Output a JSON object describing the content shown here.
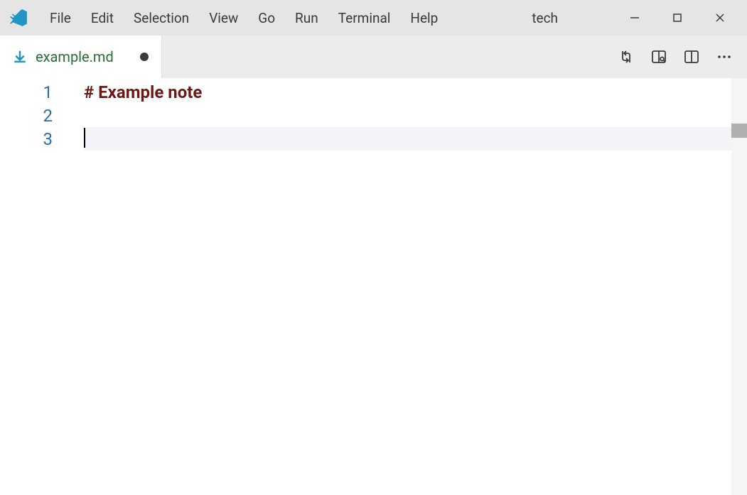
{
  "menubar": {
    "items": [
      "File",
      "Edit",
      "Selection",
      "View",
      "Go",
      "Run",
      "Terminal",
      "Help"
    ]
  },
  "window": {
    "title": "tech"
  },
  "tabs": [
    {
      "label": "example.md",
      "dirty": true
    }
  ],
  "editor": {
    "line_numbers": [
      "1",
      "2",
      "3"
    ],
    "lines": [
      {
        "text": "# Example note",
        "token": "heading"
      },
      {
        "text": "",
        "token": ""
      },
      {
        "text": "",
        "token": "",
        "active": true
      }
    ]
  }
}
